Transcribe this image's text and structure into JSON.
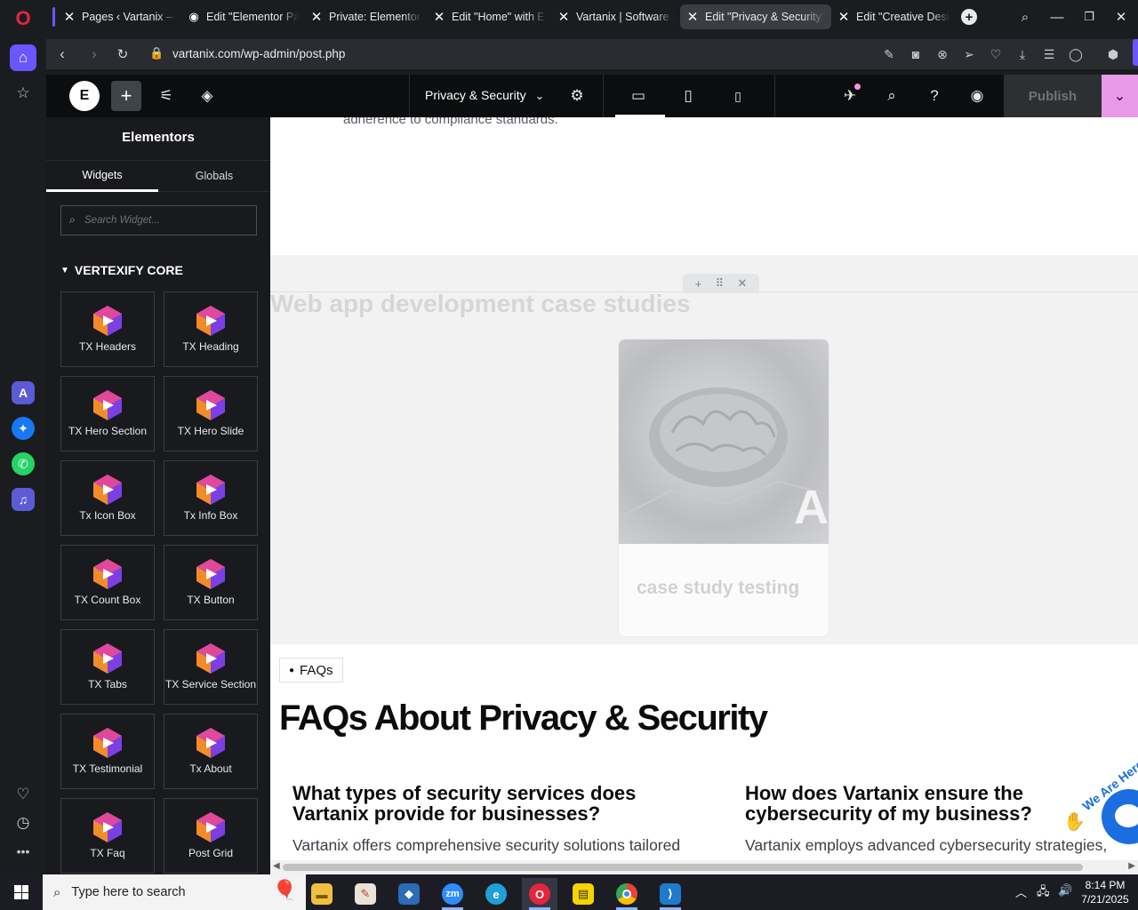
{
  "browser": {
    "tabs": [
      {
        "label": "Pages ‹ Vartanix — WordPress",
        "icon": "wordpress-x-icon"
      },
      {
        "label": "Edit \"Elementor Page\"",
        "icon": "wordpress-globe-icon"
      },
      {
        "label": "Private: Elementor Page",
        "icon": "wordpress-x-icon"
      },
      {
        "label": "Edit \"Home\" with Elementor",
        "icon": "wordpress-x-icon"
      },
      {
        "label": "Vartanix | Software Development",
        "icon": "wordpress-x-icon"
      },
      {
        "label": "Edit \"Privacy & Security\" with Elementor",
        "icon": "wordpress-x-icon",
        "active": true
      },
      {
        "label": "Edit \"Creative Design\"",
        "icon": "wordpress-x-icon"
      }
    ],
    "url": "vartanix.com/wp-admin/post.php"
  },
  "elementor": {
    "page_name": "Privacy & Security",
    "publish_label": "Publish",
    "panel": {
      "title": "Elementors",
      "tab_widgets": "Widgets",
      "tab_globals": "Globals",
      "search_placeholder": "Search Widget...",
      "category": "VERTEXIFY CORE",
      "widgets": [
        "TX Headers",
        "TX Heading",
        "TX Hero Section",
        "TX Hero Slide",
        "Tx Icon Box",
        "Tx Info Box",
        "TX Count Box",
        "TX Button",
        "TX Tabs",
        "TX Service Section",
        "TX Testimonial",
        "Tx About",
        "TX Faq",
        "Post Grid"
      ]
    }
  },
  "canvas": {
    "top_text": "adherence to compliance standards.",
    "case_studies_title": "Web app development case studies",
    "card_title": "case study testing",
    "card_image_letter": "A",
    "faq_tag": "FAQs",
    "faq_title": "FAQs About Privacy & Security",
    "faqs": [
      {
        "question": "What types of security services does Vartanix provide for businesses?",
        "answer": "Vartanix offers comprehensive security solutions tailored"
      },
      {
        "question": "How does Vartanix ensure the cybersecurity of my business?",
        "answer": "Vartanix employs advanced cybersecurity strategies,"
      }
    ],
    "chat_badge": "We Are Here!"
  },
  "taskbar": {
    "search_placeholder": "Type here to search",
    "time": "8:14 PM",
    "date": "7/21/2025",
    "apps": [
      "file-explorer",
      "paint-app",
      "sketchup-app",
      "zoom-app",
      "edge-app",
      "opera-app",
      "sticky-notes-app",
      "chrome-app",
      "vscode-app"
    ]
  },
  "colors": {
    "elementor_accent": "#e69ae8",
    "opera_accent": "#6a55ff",
    "opera_red": "#e3263c"
  }
}
